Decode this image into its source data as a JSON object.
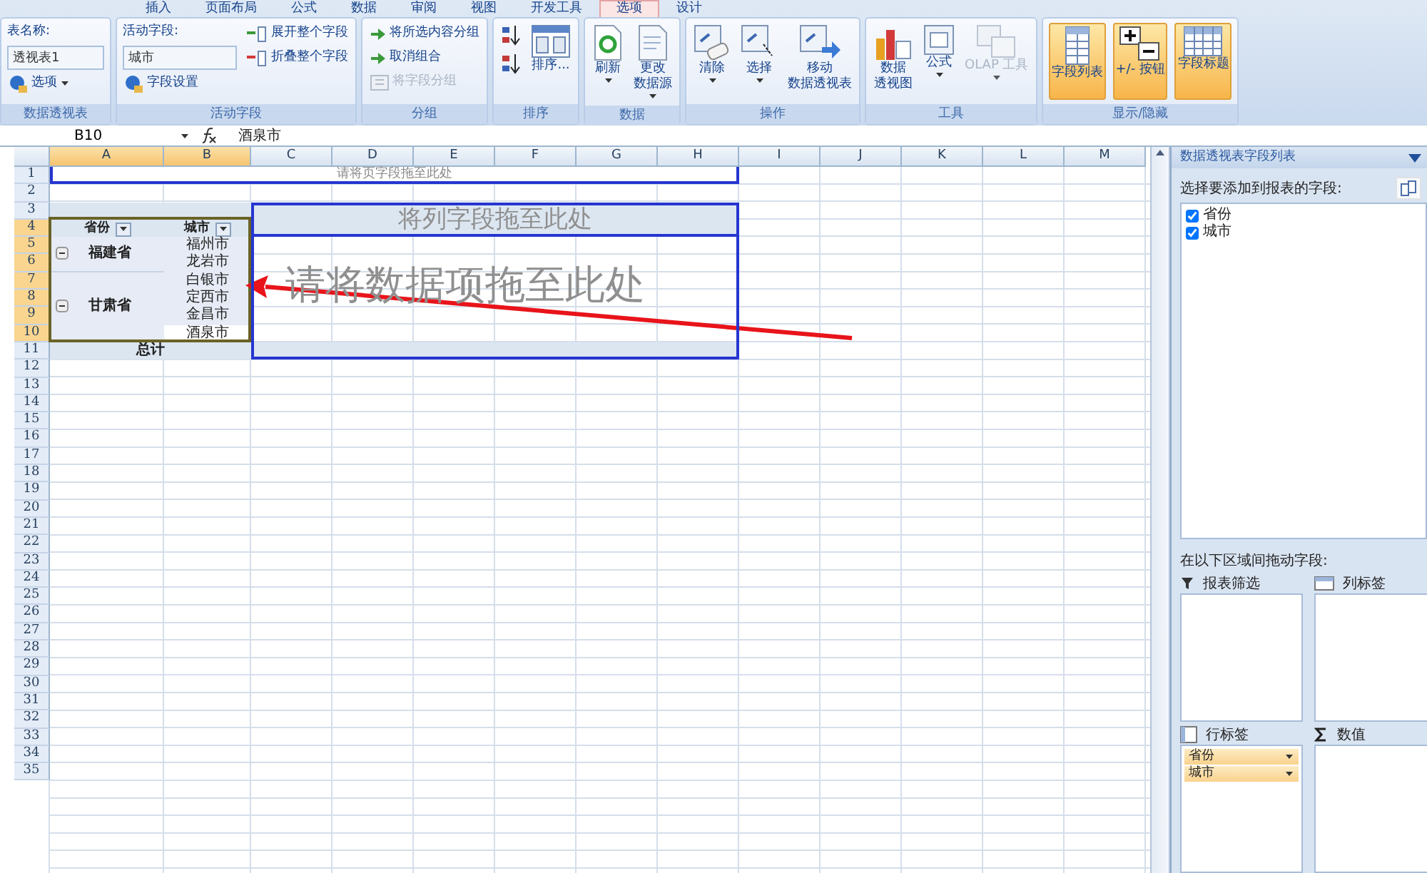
{
  "ribbon": {
    "tabs": [
      {
        "label": "插入",
        "selected": false
      },
      {
        "label": "页面布局",
        "selected": false
      },
      {
        "label": "公式",
        "selected": false
      },
      {
        "label": "数据",
        "selected": false
      },
      {
        "label": "审阅",
        "selected": false
      },
      {
        "label": "视图",
        "selected": false
      },
      {
        "label": "开发工具",
        "selected": false
      },
      {
        "label": "选项",
        "selected": true
      },
      {
        "label": "设计",
        "selected": false
      }
    ],
    "groups": [
      {
        "title": "数据透视表",
        "columns": [
          [
            {
              "kind": "label",
              "text": "表名称:"
            },
            {
              "kind": "field",
              "text": "透视表1"
            },
            {
              "kind": "small",
              "text": "选项",
              "dropdown": true,
              "disabled": false
            }
          ]
        ]
      },
      {
        "title": "活动字段",
        "columns": [
          [
            {
              "kind": "label",
              "text": "活动字段:"
            },
            {
              "kind": "field",
              "text": "城市"
            },
            {
              "kind": "small",
              "text": "字段设置",
              "disabled": false
            }
          ],
          [
            {
              "kind": "small",
              "text": "展开整个字段",
              "disabled": false
            },
            {
              "kind": "small",
              "text": "折叠整个字段",
              "disabled": false
            }
          ]
        ]
      },
      {
        "title": "分组",
        "columns": [
          [
            {
              "kind": "small",
              "text": "将所选内容分组",
              "disabled": false
            },
            {
              "kind": "small",
              "text": "取消组合",
              "disabled": false
            },
            {
              "kind": "small",
              "text": "将字段分组",
              "disabled": true
            }
          ]
        ]
      },
      {
        "title": "排序",
        "columns": [
          [
            {
              "kind": "icon",
              "disabled": false
            },
            {
              "kind": "icon",
              "disabled": false
            }
          ],
          [
            {
              "kind": "large",
              "text": "排序...",
              "disabled": false
            }
          ]
        ]
      },
      {
        "title": "数据",
        "columns": [
          [
            {
              "kind": "large",
              "text": "刷新",
              "dropdown": true,
              "disabled": false
            }
          ],
          [
            {
              "kind": "large",
              "lines": [
                "更改",
                "数据源"
              ],
              "dropdown": true,
              "disabled": false
            }
          ]
        ]
      },
      {
        "title": "操作",
        "columns": [
          [
            {
              "kind": "large",
              "text": "清除",
              "dropdown": true,
              "disabled": false
            }
          ],
          [
            {
              "kind": "large",
              "text": "选择",
              "dropdown": true,
              "disabled": false
            }
          ],
          [
            {
              "kind": "large",
              "lines": [
                "移动",
                "数据透视表"
              ],
              "disabled": false
            }
          ]
        ]
      },
      {
        "title": "工具",
        "columns": [
          [
            {
              "kind": "large",
              "lines": [
                "数据",
                "透视图"
              ],
              "disabled": false
            }
          ],
          [
            {
              "kind": "large",
              "text": "公式",
              "dropdown": true,
              "disabled": false
            }
          ],
          [
            {
              "kind": "large",
              "text": "OLAP 工具",
              "dropdown": true,
              "disabled": true
            }
          ]
        ]
      },
      {
        "title": "显示/隐藏",
        "columns": [
          [
            {
              "kind": "toggle",
              "text": "字段列表",
              "on": true,
              "disabled": false
            }
          ],
          [
            {
              "kind": "toggle",
              "text": "+/- 按钮",
              "on": true,
              "disabled": false
            }
          ],
          [
            {
              "kind": "toggle",
              "text": "字段标题",
              "on": true,
              "disabled": false
            }
          ]
        ]
      }
    ]
  },
  "formula_bar": {
    "name_box": "B10",
    "formula": "酒泉市"
  },
  "sheet": {
    "columns": [
      {
        "label": "A",
        "selected": true
      },
      {
        "label": "B",
        "selected": true
      },
      {
        "label": "C",
        "selected": false
      },
      {
        "label": "D",
        "selected": false
      },
      {
        "label": "E",
        "selected": false
      },
      {
        "label": "F",
        "selected": false
      },
      {
        "label": "G",
        "selected": false
      },
      {
        "label": "H",
        "selected": false
      },
      {
        "label": "I",
        "selected": false
      },
      {
        "label": "J",
        "selected": false
      },
      {
        "label": "K",
        "selected": false
      },
      {
        "label": "L",
        "selected": false
      },
      {
        "label": "M",
        "selected": false
      }
    ],
    "rows": [
      {
        "label": "1",
        "selected": false
      },
      {
        "label": "2",
        "selected": false
      },
      {
        "label": "3",
        "selected": false
      },
      {
        "label": "4",
        "selected": true
      },
      {
        "label": "5",
        "selected": true
      },
      {
        "label": "6",
        "selected": true
      },
      {
        "label": "7",
        "selected": true
      },
      {
        "label": "8",
        "selected": true
      },
      {
        "label": "9",
        "selected": true
      },
      {
        "label": "10",
        "selected": true
      },
      {
        "label": "11",
        "selected": false
      },
      {
        "label": "12",
        "selected": false
      },
      {
        "label": "13",
        "selected": false
      },
      {
        "label": "14",
        "selected": false
      },
      {
        "label": "15",
        "selected": false
      },
      {
        "label": "16",
        "selected": false
      },
      {
        "label": "17",
        "selected": false
      },
      {
        "label": "18",
        "selected": false
      },
      {
        "label": "19",
        "selected": false
      },
      {
        "label": "20",
        "selected": false
      },
      {
        "label": "21",
        "selected": false
      },
      {
        "label": "22",
        "selected": false
      },
      {
        "label": "23",
        "selected": false
      },
      {
        "label": "24",
        "selected": false
      },
      {
        "label": "25",
        "selected": false
      },
      {
        "label": "26",
        "selected": false
      },
      {
        "label": "27",
        "selected": false
      },
      {
        "label": "28",
        "selected": false
      },
      {
        "label": "29",
        "selected": false
      },
      {
        "label": "30",
        "selected": false
      },
      {
        "label": "31",
        "selected": false
      },
      {
        "label": "32",
        "selected": false
      },
      {
        "label": "33",
        "selected": false
      },
      {
        "label": "34",
        "selected": false
      },
      {
        "label": "35",
        "selected": false
      }
    ],
    "pivot": {
      "page_drop": "请将页字段拖至此处",
      "column_drop": "将列字段拖至此处",
      "data_drop": "请将数据项拖至此处",
      "headers": [
        "省份",
        "城市"
      ],
      "groups": [
        {
          "label": "福建省",
          "expanded": true,
          "children": [
            {
              "label": "福州市",
              "selected": false
            },
            {
              "label": "龙岩市",
              "selected": false
            }
          ]
        },
        {
          "label": "甘肃省",
          "expanded": true,
          "children": [
            {
              "label": "白银市",
              "selected": false
            },
            {
              "label": "定西市",
              "selected": false
            },
            {
              "label": "金昌市",
              "selected": false
            },
            {
              "label": "酒泉市",
              "selected": true
            }
          ]
        }
      ],
      "total": "总计"
    }
  },
  "field_list": {
    "title": "数据透视表字段列表",
    "prompt": "选择要添加到报表的字段:",
    "fields": [
      {
        "label": "省份",
        "checked": true
      },
      {
        "label": "城市",
        "checked": true
      }
    ],
    "areas_prompt": "在以下区域间拖动字段:",
    "areas": [
      {
        "kind": "filter",
        "title": "报表筛选"
      },
      {
        "kind": "column",
        "title": "列标签"
      },
      {
        "kind": "row",
        "title": "行标签",
        "items": [
          "省份",
          "城市"
        ]
      },
      {
        "kind": "values",
        "title": "数值"
      }
    ]
  }
}
